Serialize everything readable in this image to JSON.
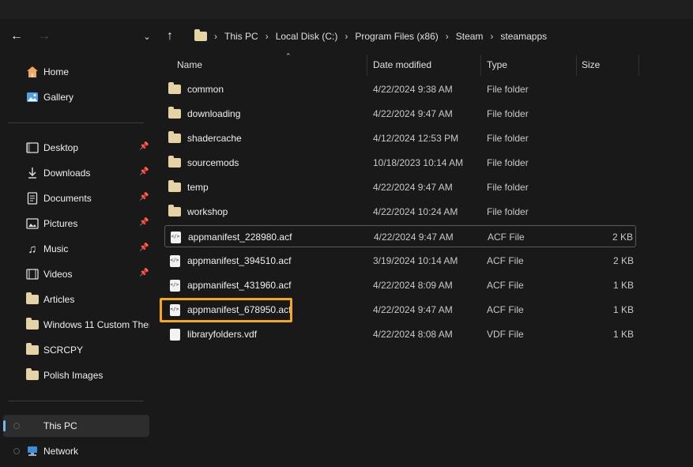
{
  "nav": {
    "back_icon": "arrow-left-icon",
    "forward_icon": "arrow-right-icon",
    "history_icon": "chevron-down-icon",
    "up_icon": "arrow-up-icon"
  },
  "breadcrumb": [
    "This PC",
    "Local Disk (C:)",
    "Program Files (x86)",
    "Steam",
    "steamapps"
  ],
  "sidebar": {
    "top": [
      {
        "label": "Home",
        "icon": "home-icon"
      },
      {
        "label": "Gallery",
        "icon": "gallery-icon"
      }
    ],
    "pinned": [
      {
        "label": "Desktop",
        "icon": "desktop-icon"
      },
      {
        "label": "Downloads",
        "icon": "download-icon"
      },
      {
        "label": "Documents",
        "icon": "document-icon"
      },
      {
        "label": "Pictures",
        "icon": "picture-icon"
      },
      {
        "label": "Music",
        "icon": "music-icon"
      },
      {
        "label": "Videos",
        "icon": "video-icon"
      },
      {
        "label": "Articles",
        "icon": "folder-icon"
      },
      {
        "label": "Windows 11 Custom Ther",
        "icon": "folder-icon"
      },
      {
        "label": "SCRCPY",
        "icon": "folder-icon"
      },
      {
        "label": "Polish Images",
        "icon": "folder-icon"
      }
    ],
    "bottom": [
      {
        "label": "This PC",
        "icon": "computer-icon"
      },
      {
        "label": "Network",
        "icon": "network-icon"
      }
    ]
  },
  "columns": {
    "name": "Name",
    "date": "Date modified",
    "type": "Type",
    "size": "Size"
  },
  "files": [
    {
      "name": "common",
      "date": "4/22/2024 9:38 AM",
      "type": "File folder",
      "size": "",
      "kind": "folder"
    },
    {
      "name": "downloading",
      "date": "4/22/2024 9:47 AM",
      "type": "File folder",
      "size": "",
      "kind": "folder"
    },
    {
      "name": "shadercache",
      "date": "4/12/2024 12:53 PM",
      "type": "File folder",
      "size": "",
      "kind": "folder"
    },
    {
      "name": "sourcemods",
      "date": "10/18/2023 10:14 AM",
      "type": "File folder",
      "size": "",
      "kind": "folder"
    },
    {
      "name": "temp",
      "date": "4/22/2024 9:47 AM",
      "type": "File folder",
      "size": "",
      "kind": "folder"
    },
    {
      "name": "workshop",
      "date": "4/22/2024 10:24 AM",
      "type": "File folder",
      "size": "",
      "kind": "folder"
    },
    {
      "name": "appmanifest_228980.acf",
      "date": "4/22/2024 9:47 AM",
      "type": "ACF File",
      "size": "2 KB",
      "kind": "code"
    },
    {
      "name": "appmanifest_394510.acf",
      "date": "3/19/2024 10:14 AM",
      "type": "ACF File",
      "size": "2 KB",
      "kind": "code"
    },
    {
      "name": "appmanifest_431960.acf",
      "date": "4/22/2024 8:09 AM",
      "type": "ACF File",
      "size": "1 KB",
      "kind": "code"
    },
    {
      "name": "appmanifest_678950.acf",
      "date": "4/22/2024 9:47 AM",
      "type": "ACF File",
      "size": "1 KB",
      "kind": "code"
    },
    {
      "name": "libraryfolders.vdf",
      "date": "4/22/2024 8:08 AM",
      "type": "VDF File",
      "size": "1 KB",
      "kind": "file"
    }
  ],
  "colors": {
    "highlight": "#f5a81c",
    "folder": "#e6d3a3",
    "accent": "#76b9ed"
  }
}
